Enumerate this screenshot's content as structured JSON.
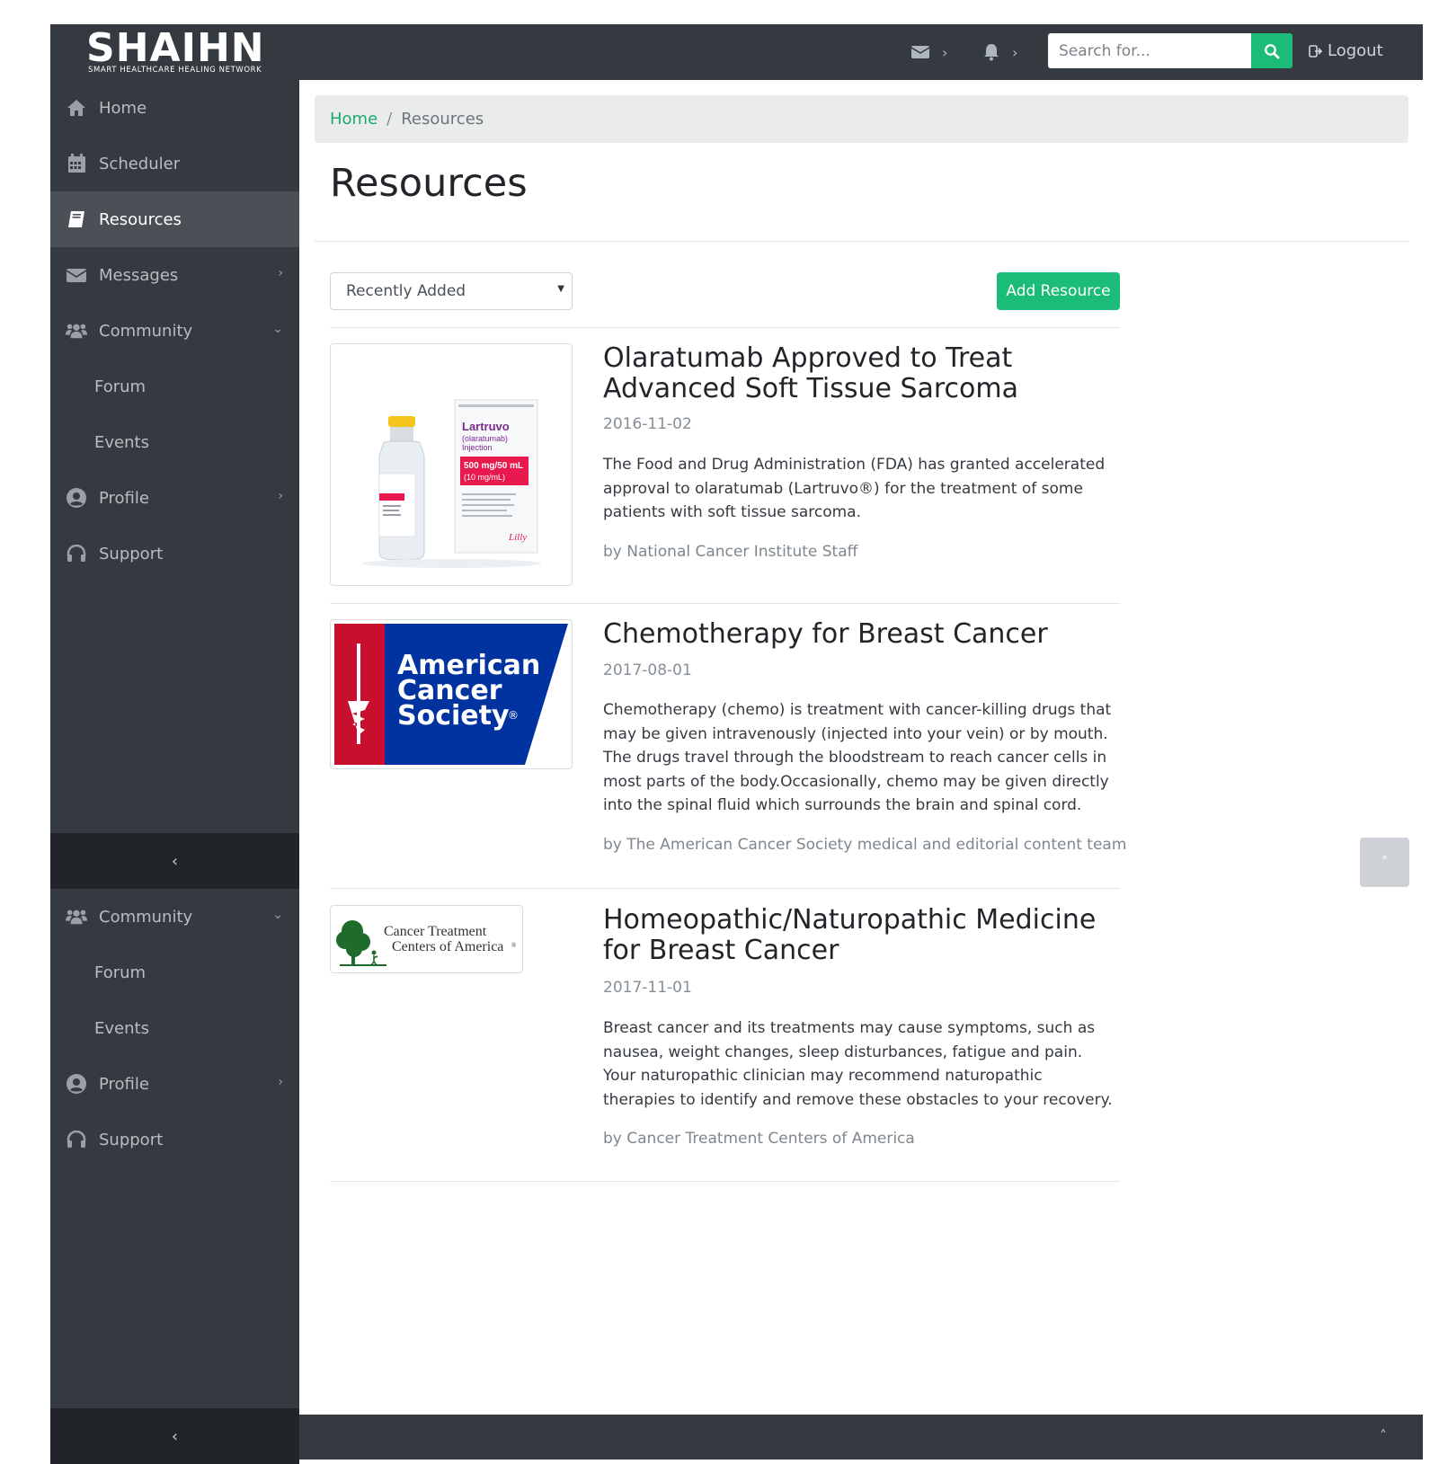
{
  "brand": {
    "name_left": "SH",
    "name_mid": "AI",
    "name_right": "HN",
    "tagline": "SMART HEALTHCARE HEALING NETWORK"
  },
  "header": {
    "messages_icon": "envelope-icon",
    "notifications_icon": "bell-icon",
    "search_placeholder": "Search for...",
    "search_icon": "search-icon",
    "logout_label": "Logout",
    "accent": "#1abc78"
  },
  "sidebar": {
    "items": [
      {
        "label": "Home",
        "icon": "home-icon"
      },
      {
        "label": "Scheduler",
        "icon": "calendar-icon"
      },
      {
        "label": "Resources",
        "icon": "book-icon",
        "active": true
      },
      {
        "label": "Messages",
        "icon": "envelope-icon"
      },
      {
        "label": "Community",
        "icon": "users-icon"
      },
      {
        "label": "Forum"
      },
      {
        "label": "Events"
      },
      {
        "label": "Profile",
        "icon": "user-circle-icon"
      },
      {
        "label": "Support",
        "icon": "headset-icon"
      }
    ],
    "items2": [
      {
        "label": "Community",
        "icon": "users-icon"
      },
      {
        "label": "Forum"
      },
      {
        "label": "Events"
      },
      {
        "label": "Profile",
        "icon": "user-circle-icon"
      },
      {
        "label": "Support",
        "icon": "headset-icon"
      }
    ]
  },
  "breadcrumb": {
    "home": "Home",
    "separator": "/",
    "current": "Resources"
  },
  "page": {
    "title": "Resources",
    "sort_selected": "Recently Added",
    "add_button": "Add Resource"
  },
  "resources": [
    {
      "title": "Olaratumab Approved to Treat Advanced Soft Tissue Sarcoma",
      "date": "2016-11-02",
      "description": "The Food and Drug Administration (FDA) has granted accelerated approval to olaratumab (Lartruvo®) for the treatment of some patients with soft tissue sarcoma.",
      "author": "by National Cancer Institute Staff",
      "image": {
        "brand": "Lartruvo",
        "generic": "(olaratumab)",
        "form": "Injection",
        "dose": "500 mg/50 mL",
        "conc": "(10 mg/mL)",
        "maker": "Lilly"
      }
    },
    {
      "title": "Chemotherapy for Breast Cancer",
      "date": "2017-08-01",
      "description": "Chemotherapy (chemo) is treatment with cancer-killing drugs that may be given intravenously (injected into your vein) or by mouth. The drugs travel through the bloodstream to reach cancer cells in most parts of the body.Occasionally, chemo may be given directly into the spinal fluid which surrounds the brain and spinal cord.",
      "author": "by The American Cancer Society medical and editorial content team",
      "image": {
        "line1": "American",
        "line2": "Cancer",
        "line3": "Society",
        "mark": "®",
        "blue": "#0033a0",
        "red": "#c8102e"
      }
    },
    {
      "title": "Homeopathic/Naturopathic Medicine for Breast Cancer",
      "date": "2017-11-01",
      "description": "Breast cancer and its treatments may cause symptoms, such as nausea, weight changes, sleep disturbances, fatigue and pain. Your naturopathic clinician may recommend naturopathic therapies to identify and remove these obstacles to your recovery.",
      "author": "by Cancer Treatment Centers of America",
      "image": {
        "line1": "Cancer Treatment",
        "line2": "Centers of America",
        "mark": "®"
      }
    }
  ]
}
